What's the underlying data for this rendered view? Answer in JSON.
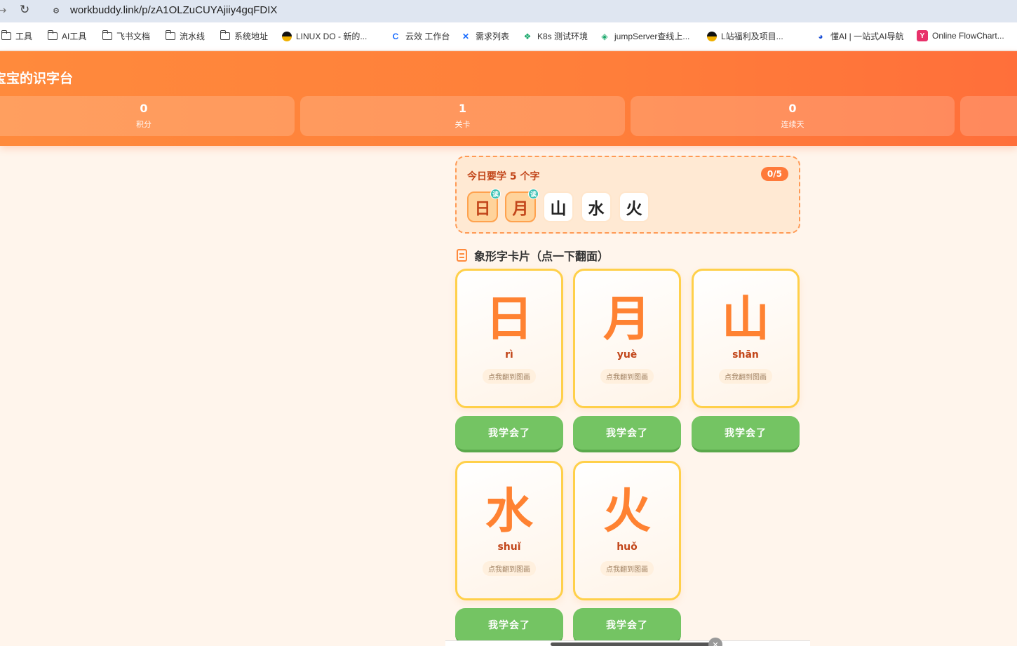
{
  "browser": {
    "url": "workbuddy.link/p/zA1OLZuCUYAjiiy4gqFDIX",
    "bookmarks": [
      {
        "label": "工具",
        "icon": "folder-icon"
      },
      {
        "label": "AI工具",
        "icon": "folder-icon"
      },
      {
        "label": "飞书文档",
        "icon": "folder-icon"
      },
      {
        "label": "流水线",
        "icon": "folder-icon"
      },
      {
        "label": "系统地址",
        "icon": "folder-icon"
      },
      {
        "label": "LINUX DO - 新的...",
        "icon": "linuxdo-icon"
      },
      {
        "label": "云效 工作台",
        "icon": "yunxiao-icon"
      },
      {
        "label": "需求列表",
        "icon": "x-icon"
      },
      {
        "label": "K8s 测试环境",
        "icon": "k8s-icon"
      },
      {
        "label": "jumpServer查线上...",
        "icon": "jumpserver-icon"
      },
      {
        "label": "L站福利及项目...",
        "icon": "lsite-icon"
      },
      {
        "label": "懂AI | 一站式AI导航",
        "icon": "dongai-icon"
      },
      {
        "label": "Online FlowChart...",
        "icon": "flowchart-icon"
      }
    ]
  },
  "header": {
    "title": "宝宝的识字台",
    "stats": [
      {
        "value": "0",
        "label": "积分"
      },
      {
        "value": "1",
        "label": "关卡"
      },
      {
        "value": "0",
        "label": "连续天"
      }
    ]
  },
  "today": {
    "title": "今日要学 5 个字",
    "progress": "0/5",
    "chars": [
      {
        "char": "日",
        "done": true
      },
      {
        "char": "月",
        "done": true
      },
      {
        "char": "山",
        "done": false
      },
      {
        "char": "水",
        "done": false
      },
      {
        "char": "火",
        "done": false
      }
    ],
    "done_mark": "读"
  },
  "section": {
    "title": "象形字卡片（点一下翻面）"
  },
  "cards": [
    {
      "char": "日",
      "pinyin": "rì",
      "hint": "点我翻到图画",
      "button": "我学会了"
    },
    {
      "char": "月",
      "pinyin": "yuè",
      "hint": "点我翻到图画",
      "button": "我学会了"
    },
    {
      "char": "山",
      "pinyin": "shān",
      "hint": "点我翻到图画",
      "button": "我学会了"
    },
    {
      "char": "水",
      "pinyin": "shuǐ",
      "hint": "点我翻到图画",
      "button": "我学会了"
    },
    {
      "char": "火",
      "pinyin": "huǒ",
      "hint": "点我翻到图画",
      "button": "我学会了"
    }
  ],
  "colors": {
    "accent": "#ff7e3a",
    "card_border": "#ffd04a",
    "button": "#74c463",
    "done_mark": "#39c0b3"
  }
}
